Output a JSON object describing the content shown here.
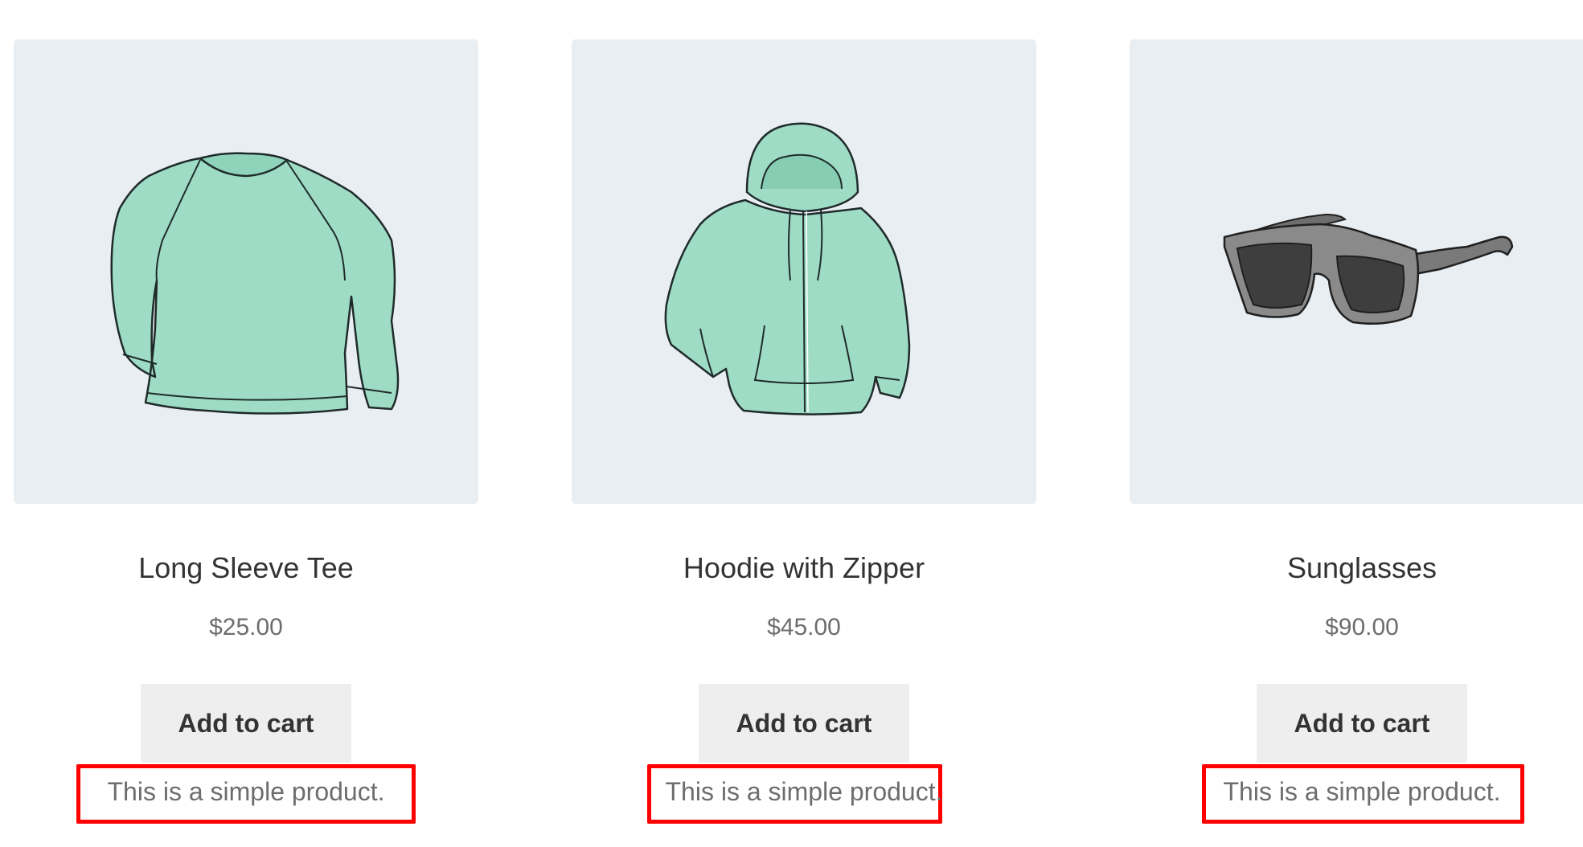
{
  "products": [
    {
      "name": "Long Sleeve Tee",
      "price": "$25.00",
      "button_label": "Add to cart",
      "description": "This is a simple product.",
      "image_icon": "long-sleeve-tee-illustration"
    },
    {
      "name": "Hoodie with Zipper",
      "price": "$45.00",
      "button_label": "Add to cart",
      "description": "This is a simple product.",
      "image_icon": "hoodie-illustration"
    },
    {
      "name": "Sunglasses",
      "price": "$90.00",
      "button_label": "Add to cart",
      "description": "This is a simple product.",
      "image_icon": "sunglasses-illustration"
    }
  ],
  "colors": {
    "thumbnail_background": "#e9eef2",
    "garment_fill": "#9fdcc6",
    "highlight_border": "#ff0000",
    "button_background": "#eeeeee",
    "price_text": "#6d6d6d"
  }
}
